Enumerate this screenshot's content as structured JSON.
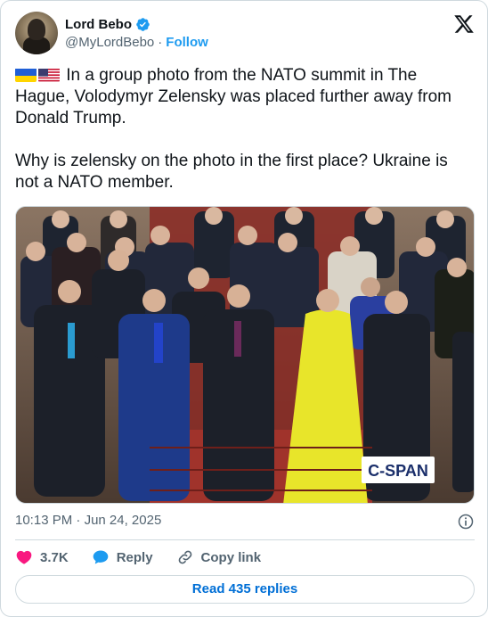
{
  "author": {
    "name": "Lord Bebo",
    "handle": "@MyLordBebo",
    "separator": "·",
    "follow_label": "Follow"
  },
  "tweet": {
    "line1": " In a group photo from the NATO summit in The Hague, Volodymyr Zelensky was placed further away from Donald Trump.",
    "line2": "Why is zelensky on the photo in the first place? Ukraine is not a NATO member.",
    "flags": [
      "ukraine-flag",
      "usa-flag"
    ]
  },
  "media": {
    "watermark": "C-SPAN"
  },
  "meta": {
    "time": "10:13 PM",
    "separator": "·",
    "date": "Jun 24, 2025"
  },
  "actions": {
    "likes": "3.7K",
    "reply_label": "Reply",
    "copy_link_label": "Copy link"
  },
  "read_replies_label": "Read 435 replies",
  "colors": {
    "accent": "#1d9bf0",
    "like": "#f91880",
    "muted": "#536471",
    "link": "#006fd6"
  }
}
